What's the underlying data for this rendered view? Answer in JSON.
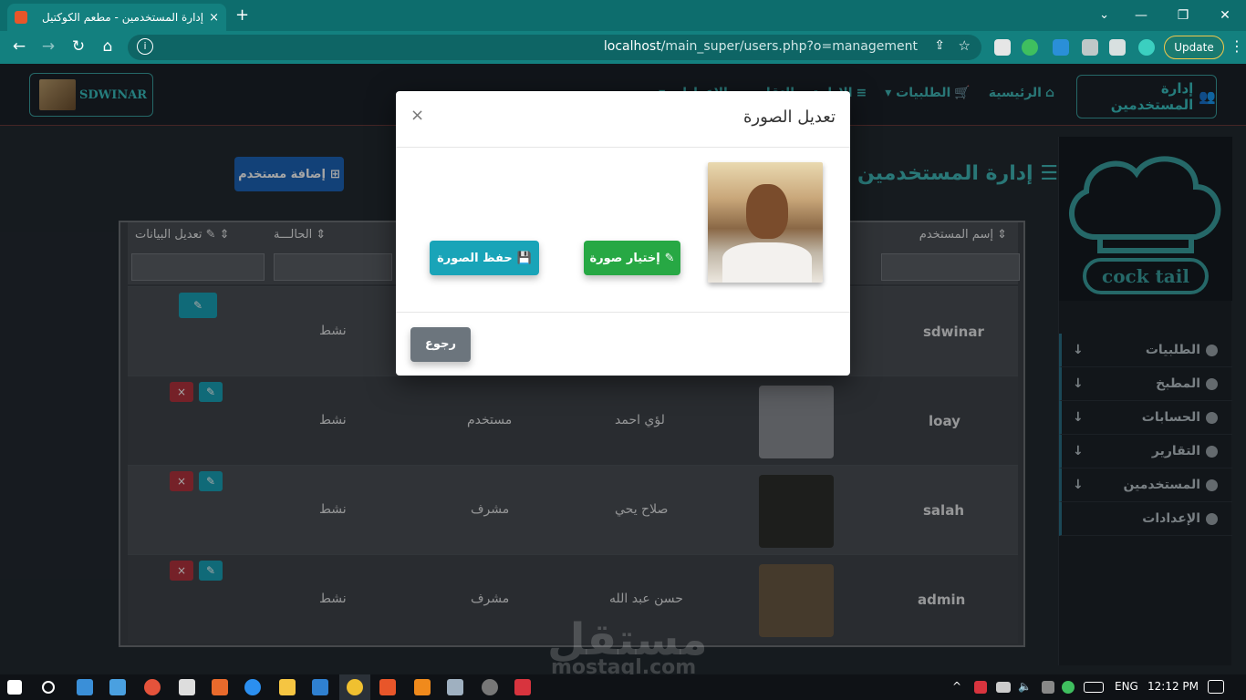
{
  "browser": {
    "tab_title": "إدارة المستخدمين - مطعم الكوكتيل",
    "tab_close": "×",
    "new_tab": "+",
    "tab_drop": "⌄",
    "window_min": "—",
    "window_max": "❐",
    "window_close": "✕",
    "url_host": "localhost",
    "url_path": "/main_super/users.php?o=management",
    "update_label": "Update"
  },
  "nav": {
    "logo_text": "SDWINAR",
    "links": [
      "الرئيسية",
      "الطلبيات",
      "الإدارة",
      "التقارير",
      "الإعدادات"
    ],
    "brand": "إدارة المستخدمين"
  },
  "sidebar": {
    "items": [
      "الطلبيات",
      "المطبخ",
      "الحسابات",
      "التقارير",
      "المستخدمين",
      "الإعدادات"
    ]
  },
  "page": {
    "title": "إدارة المستخدمين",
    "add_button": "إضافة مستخدم"
  },
  "table": {
    "headers": [
      "إسم المستخدم",
      "الحالـــة",
      "تعديل البيانات"
    ],
    "rows": [
      {
        "username": "sdwinar",
        "name": "",
        "role": "",
        "status": "نشط"
      },
      {
        "username": "loay",
        "name": "لؤي احمد",
        "role": "مستخدم",
        "status": "نشط"
      },
      {
        "username": "salah",
        "name": "صلاح يحي",
        "role": "مشرف",
        "status": "نشط"
      },
      {
        "username": "admin",
        "name": "حسن عبد الله",
        "role": "مشرف",
        "status": "نشط"
      }
    ]
  },
  "modal": {
    "title": "تعديل الصورة",
    "close": "×",
    "choose_label": "إختيار صورة",
    "save_label": "حفظ الصورة",
    "back_label": "رجوع"
  },
  "watermark": {
    "arabic": "مستقل",
    "latin": "mostaql.com"
  },
  "taskbar": {
    "lang": "ENG",
    "time": "12:12 PM"
  }
}
